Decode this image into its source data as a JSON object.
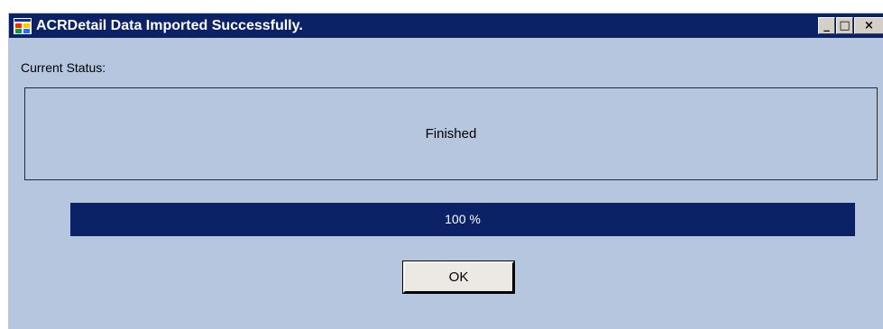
{
  "window": {
    "title": "ACRDetail Data Imported Successfully.",
    "icon": "application-window-icon",
    "controls": {
      "minimize": "_",
      "maximize": "□",
      "close": "×"
    }
  },
  "status": {
    "label": "Current Status:",
    "value": "Finished"
  },
  "progress": {
    "percent": 100,
    "text": "100 %"
  },
  "buttons": {
    "ok": "OK"
  },
  "colors": {
    "titlebar": "#0b2266",
    "dialog_background": "#b6c6df",
    "progress_fill": "#0b2266"
  }
}
